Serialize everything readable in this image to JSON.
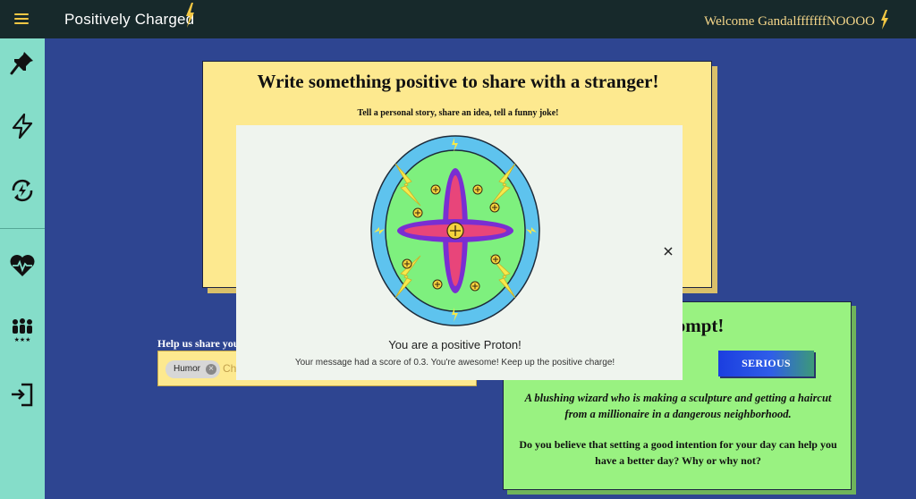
{
  "header": {
    "brand": "Positively Charged",
    "welcome": "Welcome GandalfffffffNOOOO"
  },
  "sidebar": {
    "items": [
      {
        "icon": "pin-icon"
      },
      {
        "icon": "lightning-icon"
      },
      {
        "icon": "refresh-charge-icon"
      },
      {
        "icon": "heartbeat-icon"
      },
      {
        "icon": "community-icon"
      },
      {
        "icon": "logout-icon"
      }
    ]
  },
  "write_card": {
    "title": "Write something positive to share with a stranger!",
    "subtitle": "Tell a personal story, share an idea, tell a funny joke!"
  },
  "tags": {
    "label": "Help us share you",
    "chip": "Humor",
    "input_placeholder": "Ch"
  },
  "prompt_card": {
    "title": "ily Prompt!",
    "serious_label": "SERIOUS",
    "prompt_text": "A blushing wizard who is making a sculpture and getting a haircut from a millionaire in a dangerous neighborhood.",
    "question": "Do you believe that setting a good intention for your day can help you have a better day? Why or why not?"
  },
  "modal": {
    "title": "You are a positive Proton!",
    "message": "Your message had a score of 0.3. You're awesome! Keep up the positive charge!",
    "close_icon": "close-icon",
    "image_icon": "proton-icon"
  },
  "colors": {
    "background": "#2e4591",
    "topbar": "#17292b",
    "sidebar": "#85ddc9",
    "write_card": "#fde98f",
    "prompt_card": "#99f281",
    "accent": "#f2c744"
  }
}
